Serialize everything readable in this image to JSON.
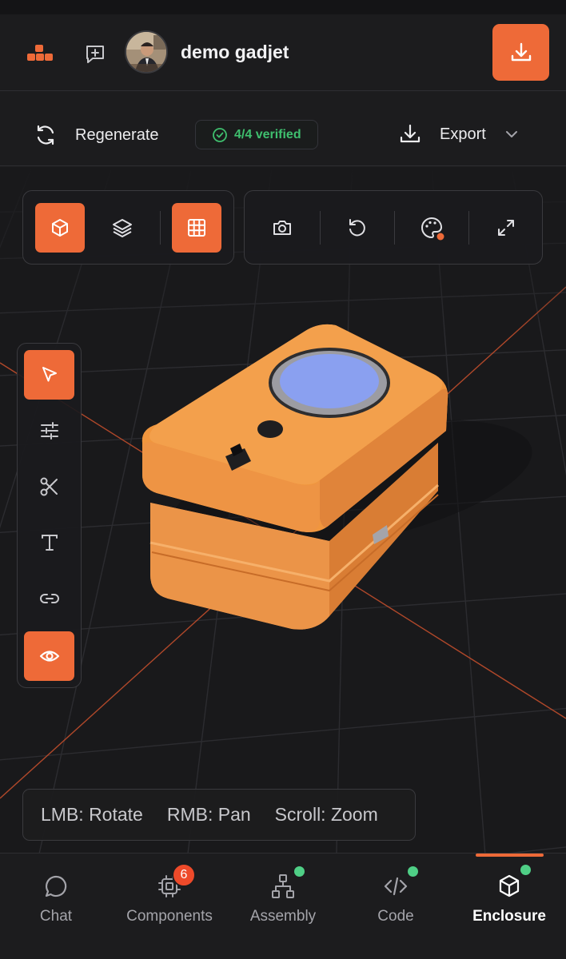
{
  "header": {
    "project_title": "demo gadjet"
  },
  "actionbar": {
    "regenerate_label": "Regenerate",
    "verified_label": "4/4 verified",
    "export_label": "Export"
  },
  "viewport": {
    "hint_rotate": "LMB: Rotate",
    "hint_pan": "RMB: Pan",
    "hint_zoom": "Scroll: Zoom"
  },
  "bottom_nav": {
    "items": [
      {
        "label": "Chat"
      },
      {
        "label": "Components",
        "badge": "6"
      },
      {
        "label": "Assembly"
      },
      {
        "label": "Code"
      },
      {
        "label": "Enclosure"
      }
    ]
  },
  "colors": {
    "accent": "#ee6a38",
    "verified_green": "#3fbf6e",
    "status_dot": "#4fcf86"
  }
}
